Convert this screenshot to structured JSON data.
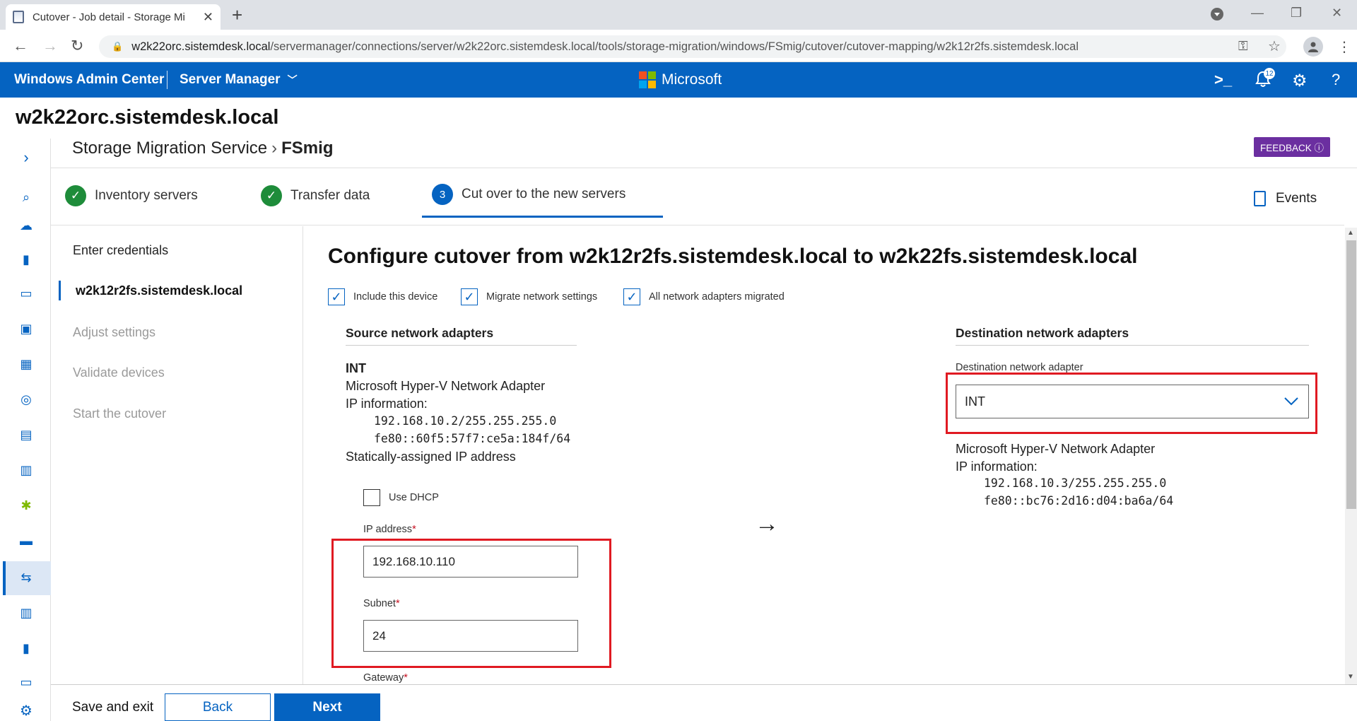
{
  "browser": {
    "tab_title": "Cutover - Job detail - Storage Mi",
    "url_host": "w2k22orc.sistemdesk.local",
    "url_path": "/servermanager/connections/server/w2k22orc.sistemdesk.local/tools/storage-migration/windows/FSmig/cutover/cutover-mapping/w2k12r2fs.sistemdesk.local"
  },
  "header": {
    "app_name": "Windows Admin Center",
    "tool_menu": "Server Manager",
    "brand": "Microsoft",
    "notification_count": "12"
  },
  "server_name": "w2k22orc.sistemdesk.local",
  "breadcrumb": {
    "root": "Storage Migration Service",
    "current": "FSmig"
  },
  "feedback_label": "FEEDBACK ⓘ",
  "steps": [
    {
      "label": "Inventory servers",
      "status": "complete"
    },
    {
      "label": "Transfer data",
      "status": "complete"
    },
    {
      "label": "Cut over to the new servers",
      "number": "3",
      "status": "active"
    }
  ],
  "events_label": "Events",
  "substeps": [
    {
      "label": "Enter credentials",
      "state": "done"
    },
    {
      "label": "w2k12r2fs.sistemdesk.local",
      "state": "active"
    },
    {
      "label": "Adjust settings",
      "state": "disabled"
    },
    {
      "label": "Validate devices",
      "state": "disabled"
    },
    {
      "label": "Start the cutover",
      "state": "disabled"
    }
  ],
  "main": {
    "heading": "Configure cutover from w2k12r2fs.sistemdesk.local to w2k22fs.sistemdesk.local",
    "checkboxes": [
      {
        "label": "Include this device",
        "checked": true
      },
      {
        "label": "Migrate network settings",
        "checked": true
      },
      {
        "label": "All network adapters migrated",
        "checked": true
      }
    ],
    "source": {
      "section_title": "Source network adapters",
      "adapter_name": "INT",
      "adapter_desc": "Microsoft Hyper-V Network Adapter",
      "ip_info_label": "IP information:",
      "ip_v4": "192.168.10.2/255.255.255.0",
      "ip_v6": "fe80::60f5:57f7:ce5a:184f/64",
      "assignment": "Statically-assigned IP address",
      "use_dhcp_label": "Use DHCP",
      "use_dhcp_checked": false,
      "ip_label": "IP address",
      "ip_value": "192.168.10.110",
      "subnet_label": "Subnet",
      "subnet_value": "24",
      "gateway_label": "Gateway",
      "required_mark": "*"
    },
    "destination": {
      "section_title": "Destination network adapters",
      "dropdown_label": "Destination network adapter",
      "dropdown_value": "INT",
      "adapter_desc": "Microsoft Hyper-V Network Adapter",
      "ip_info_label": "IP information:",
      "ip_v4": "192.168.10.3/255.255.255.0",
      "ip_v6": "fe80::bc76:2d16:d04:ba6a/64"
    }
  },
  "footer": {
    "save_exit": "Save and exit",
    "back": "Back",
    "next": "Next"
  },
  "colors": {
    "accent": "#0563c1",
    "success": "#1e8c3a",
    "highlight": "#e01a22",
    "feedback": "#6b2fa0"
  }
}
